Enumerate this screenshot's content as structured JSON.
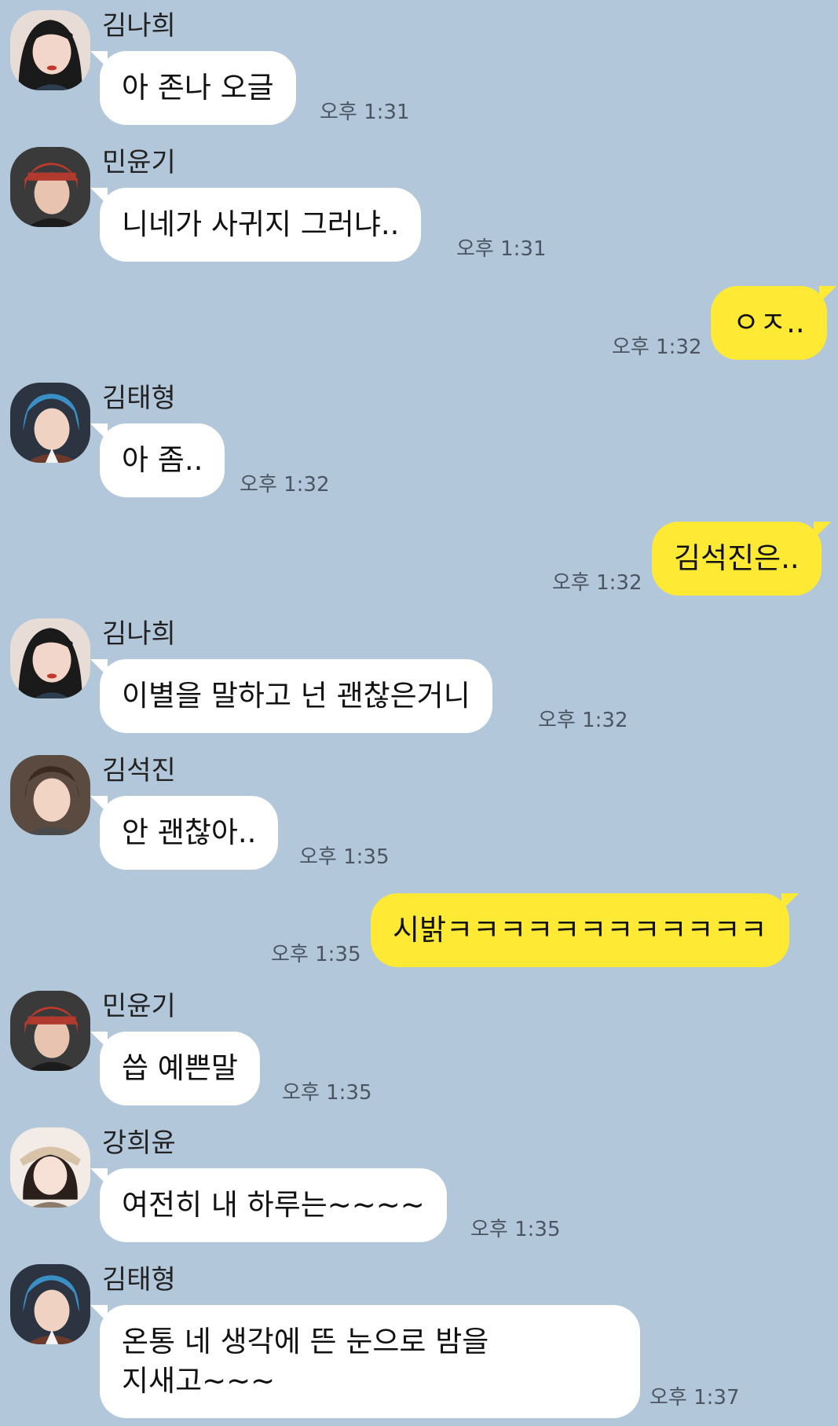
{
  "messages": [
    {
      "sender": "김나희",
      "text": "아 존나 오글",
      "time": "오후 1:31"
    },
    {
      "sender": "민윤기",
      "text": "니네가 사귀지 그러냐..",
      "time": "오후 1:31"
    },
    {
      "text": "ㅇㅈ..",
      "time": "오후 1:32"
    },
    {
      "sender": "김태형",
      "text": "아 좀..",
      "time": "오후 1:32"
    },
    {
      "text": "김석진은..",
      "time": "오후 1:32"
    },
    {
      "sender": "김나희",
      "text": "이별을 말하고 넌 괜찮은거니",
      "time": "오후 1:32"
    },
    {
      "sender": "김석진",
      "text": "안 괜찮아..",
      "time": "오후 1:35"
    },
    {
      "text": "시밝ㅋㅋㅋㅋㅋㅋㅋㅋㅋㅋㅋㅋ",
      "time": "오후 1:35"
    },
    {
      "sender": "민윤기",
      "text": "씁 예쁜말",
      "time": "오후 1:35"
    },
    {
      "sender": "강희윤",
      "text": "여전히 내 하루는~~~~",
      "time": "오후 1:35"
    },
    {
      "sender": "김태형",
      "text": "온통 네 생각에 뜬 눈으로 밤을",
      "text2": "지새고~~~",
      "time": "오후 1:37"
    }
  ]
}
